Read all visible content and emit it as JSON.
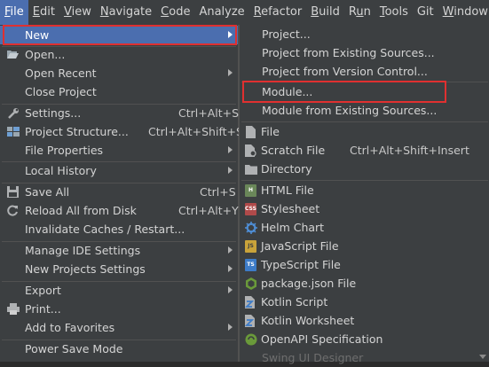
{
  "menubar": {
    "items": [
      "File",
      "Edit",
      "View",
      "Navigate",
      "Code",
      "Analyze",
      "Refactor",
      "Build",
      "Run",
      "Tools",
      "Git",
      "Window"
    ],
    "mnemonics": [
      "F",
      "E",
      "V",
      "N",
      "C",
      "",
      "R",
      "B",
      "u",
      "T",
      "",
      "W"
    ]
  },
  "file_menu": {
    "new": "New",
    "open": "Open...",
    "open_recent": "Open Recent",
    "close_project": "Close Project",
    "settings": "Settings...",
    "settings_sc": "Ctrl+Alt+S",
    "project_structure": "Project Structure...",
    "project_structure_sc": "Ctrl+Alt+Shift+S",
    "file_properties": "File Properties",
    "local_history": "Local History",
    "save_all": "Save All",
    "save_all_sc": "Ctrl+S",
    "reload": "Reload All from Disk",
    "reload_sc": "Ctrl+Alt+Y",
    "invalidate": "Invalidate Caches / Restart...",
    "manage_ide": "Manage IDE Settings",
    "new_projects_settings": "New Projects Settings",
    "export": "Export",
    "print": "Print...",
    "add_favorites": "Add to Favorites",
    "power_save": "Power Save Mode"
  },
  "new_submenu": {
    "project": "Project...",
    "from_existing": "Project from Existing Sources...",
    "from_vcs": "Project from Version Control...",
    "module": "Module...",
    "module_existing": "Module from Existing Sources...",
    "file": "File",
    "scratch": "Scratch File",
    "scratch_sc": "Ctrl+Alt+Shift+Insert",
    "directory": "Directory",
    "html": "HTML File",
    "stylesheet": "Stylesheet",
    "helm": "Helm Chart",
    "js": "JavaScript File",
    "ts": "TypeScript File",
    "package_json": "package.json File",
    "kotlin_script": "Kotlin Script",
    "kotlin_worksheet": "Kotlin Worksheet",
    "openapi": "OpenAPI Specification",
    "swing": "Swing UI Designer"
  },
  "colors": {
    "selection": "#4b6eaf",
    "menu_bg": "#3c3f41",
    "highlight": "#e03030"
  }
}
